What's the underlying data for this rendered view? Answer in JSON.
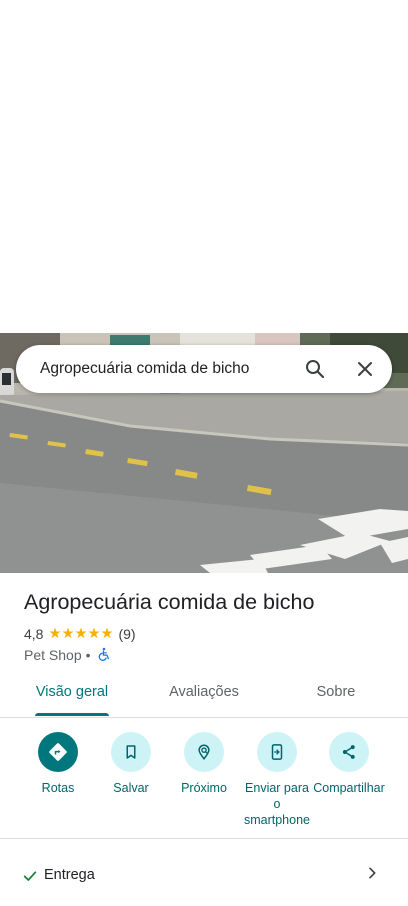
{
  "search": {
    "query": "Agropecuária comida de bicho",
    "search_icon": "search-icon",
    "close_icon": "close-icon"
  },
  "place": {
    "name": "Agropecuária comida de bicho",
    "rating": "4,8",
    "stars": "★★★★★",
    "review_count": "(9)",
    "category": "Pet Shop",
    "separator": "•",
    "accessibility_icon": "wheelchair-icon"
  },
  "tabs": [
    {
      "label": "Visão geral",
      "active": true
    },
    {
      "label": "Avaliações",
      "active": false
    },
    {
      "label": "Sobre",
      "active": false
    }
  ],
  "actions": [
    {
      "label": "Rotas",
      "icon": "directions-icon"
    },
    {
      "label": "Salvar",
      "icon": "bookmark-icon"
    },
    {
      "label": "Próximo",
      "icon": "nearby-icon"
    },
    {
      "label": "Enviar para o smartphone",
      "icon": "send-to-phone-icon"
    },
    {
      "label": "Compartilhar",
      "icon": "share-icon"
    }
  ],
  "features": [
    {
      "label": "Entrega",
      "icon": "check-icon"
    }
  ],
  "colors": {
    "accent": "#00777d",
    "action_bg": "#cdf3f7",
    "star": "#f6b100"
  }
}
